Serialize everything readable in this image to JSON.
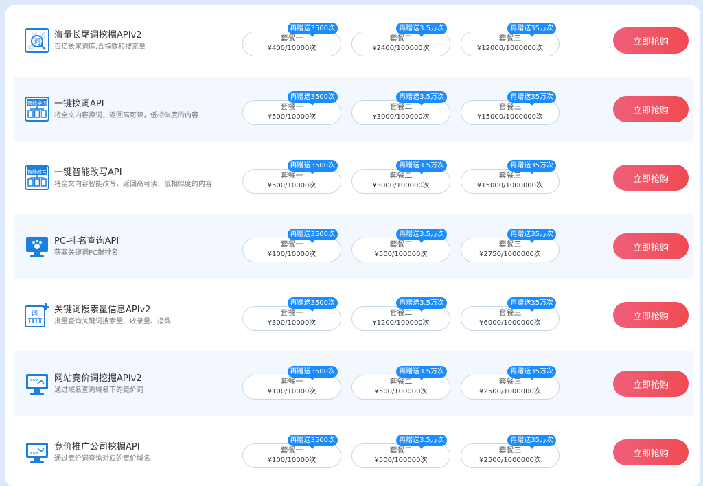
{
  "buy_label": "立即抢购",
  "products": [
    {
      "name": "海量长尾词挖掘APIv2",
      "desc": "百亿长尾词库,含指数和搜索量",
      "icon": "longtail-keywords-icon",
      "packages": [
        {
          "name": "套餐一",
          "price": "¥400/10000次",
          "badge": "再赠送3500次"
        },
        {
          "name": "套餐二",
          "price": "¥2400/100000次",
          "badge": "再赠送3.5万次"
        },
        {
          "name": "套餐三",
          "price": "¥12000/1000000次",
          "badge": "再赠送35万次"
        }
      ]
    },
    {
      "name": "一键换词API",
      "desc": "将全文内容换词，返回高可读，低相似度的内容",
      "icon": "word-replace-icon",
      "packages": [
        {
          "name": "套餐一",
          "price": "¥500/10000次",
          "badge": "再赠送3500次"
        },
        {
          "name": "套餐二",
          "price": "¥3000/100000次",
          "badge": "再赠送3.5万次"
        },
        {
          "name": "套餐三",
          "price": "¥15000/1000000次",
          "badge": "再赠送35万次"
        }
      ]
    },
    {
      "name": "一键智能改写API",
      "desc": "将全文内容智能改写，返回高可读，低相似度的内容",
      "icon": "smart-rewrite-icon",
      "packages": [
        {
          "name": "套餐一",
          "price": "¥500/10000次",
          "badge": "再赠送3500次"
        },
        {
          "name": "套餐二",
          "price": "¥3000/100000次",
          "badge": "再赠送3.5万次"
        },
        {
          "name": "套餐三",
          "price": "¥15000/1000000次",
          "badge": "再赠送35万次"
        }
      ]
    },
    {
      "name": "PC-排名查询API",
      "desc": "获取关键词PC端排名",
      "icon": "pc-ranking-icon",
      "packages": [
        {
          "name": "套餐一",
          "price": "¥100/10000次",
          "badge": "再赠送3500次"
        },
        {
          "name": "套餐二",
          "price": "¥500/100000次",
          "badge": "再赠送3.5万次"
        },
        {
          "name": "套餐三",
          "price": "¥2750/1000000次",
          "badge": "再赠送35万次"
        }
      ]
    },
    {
      "name": "关键词搜索量信息APIv2",
      "desc": "批量查询关键词搜索量、收录量、指数",
      "icon": "keyword-volume-icon",
      "packages": [
        {
          "name": "套餐一",
          "price": "¥300/10000次",
          "badge": "再赠送3500次"
        },
        {
          "name": "套餐二",
          "price": "¥1200/100000次",
          "badge": "再赠送3.5万次"
        },
        {
          "name": "套餐三",
          "price": "¥6000/1000000次",
          "badge": "再赠送35万次"
        }
      ]
    },
    {
      "name": "网站竞价词挖掘APIv2",
      "desc": "通过域名查询域名下的竞价词",
      "icon": "bid-keywords-icon",
      "packages": [
        {
          "name": "套餐一",
          "price": "¥100/10000次",
          "badge": "再赠送3500次"
        },
        {
          "name": "套餐二",
          "price": "¥500/100000次",
          "badge": "再赠送3.5万次"
        },
        {
          "name": "套餐三",
          "price": "¥2500/1000000次",
          "badge": "再赠送35万次"
        }
      ]
    },
    {
      "name": "竞价推广公司挖掘API",
      "desc": "通过竞价词查询对应的竞价域名",
      "icon": "bid-company-icon",
      "packages": [
        {
          "name": "套餐一",
          "price": "¥100/10000次",
          "badge": "再赠送3500次"
        },
        {
          "name": "套餐二",
          "price": "¥500/100000次",
          "badge": "再赠送3.5万次"
        },
        {
          "name": "套餐三",
          "price": "¥2500/1000000次",
          "badge": "再赠送35万次"
        }
      ]
    }
  ],
  "icon_texts": {
    "longtail": "词",
    "replace": "智能换词",
    "rewrite": "智能改写",
    "volume": "词",
    "www": "www"
  },
  "colors": {
    "accent": "#1a8cff",
    "buy_start": "#ef5f79",
    "buy_end": "#f04a52",
    "row_alt": "#f3f8ff",
    "page_bg": "#dbe9fb"
  }
}
